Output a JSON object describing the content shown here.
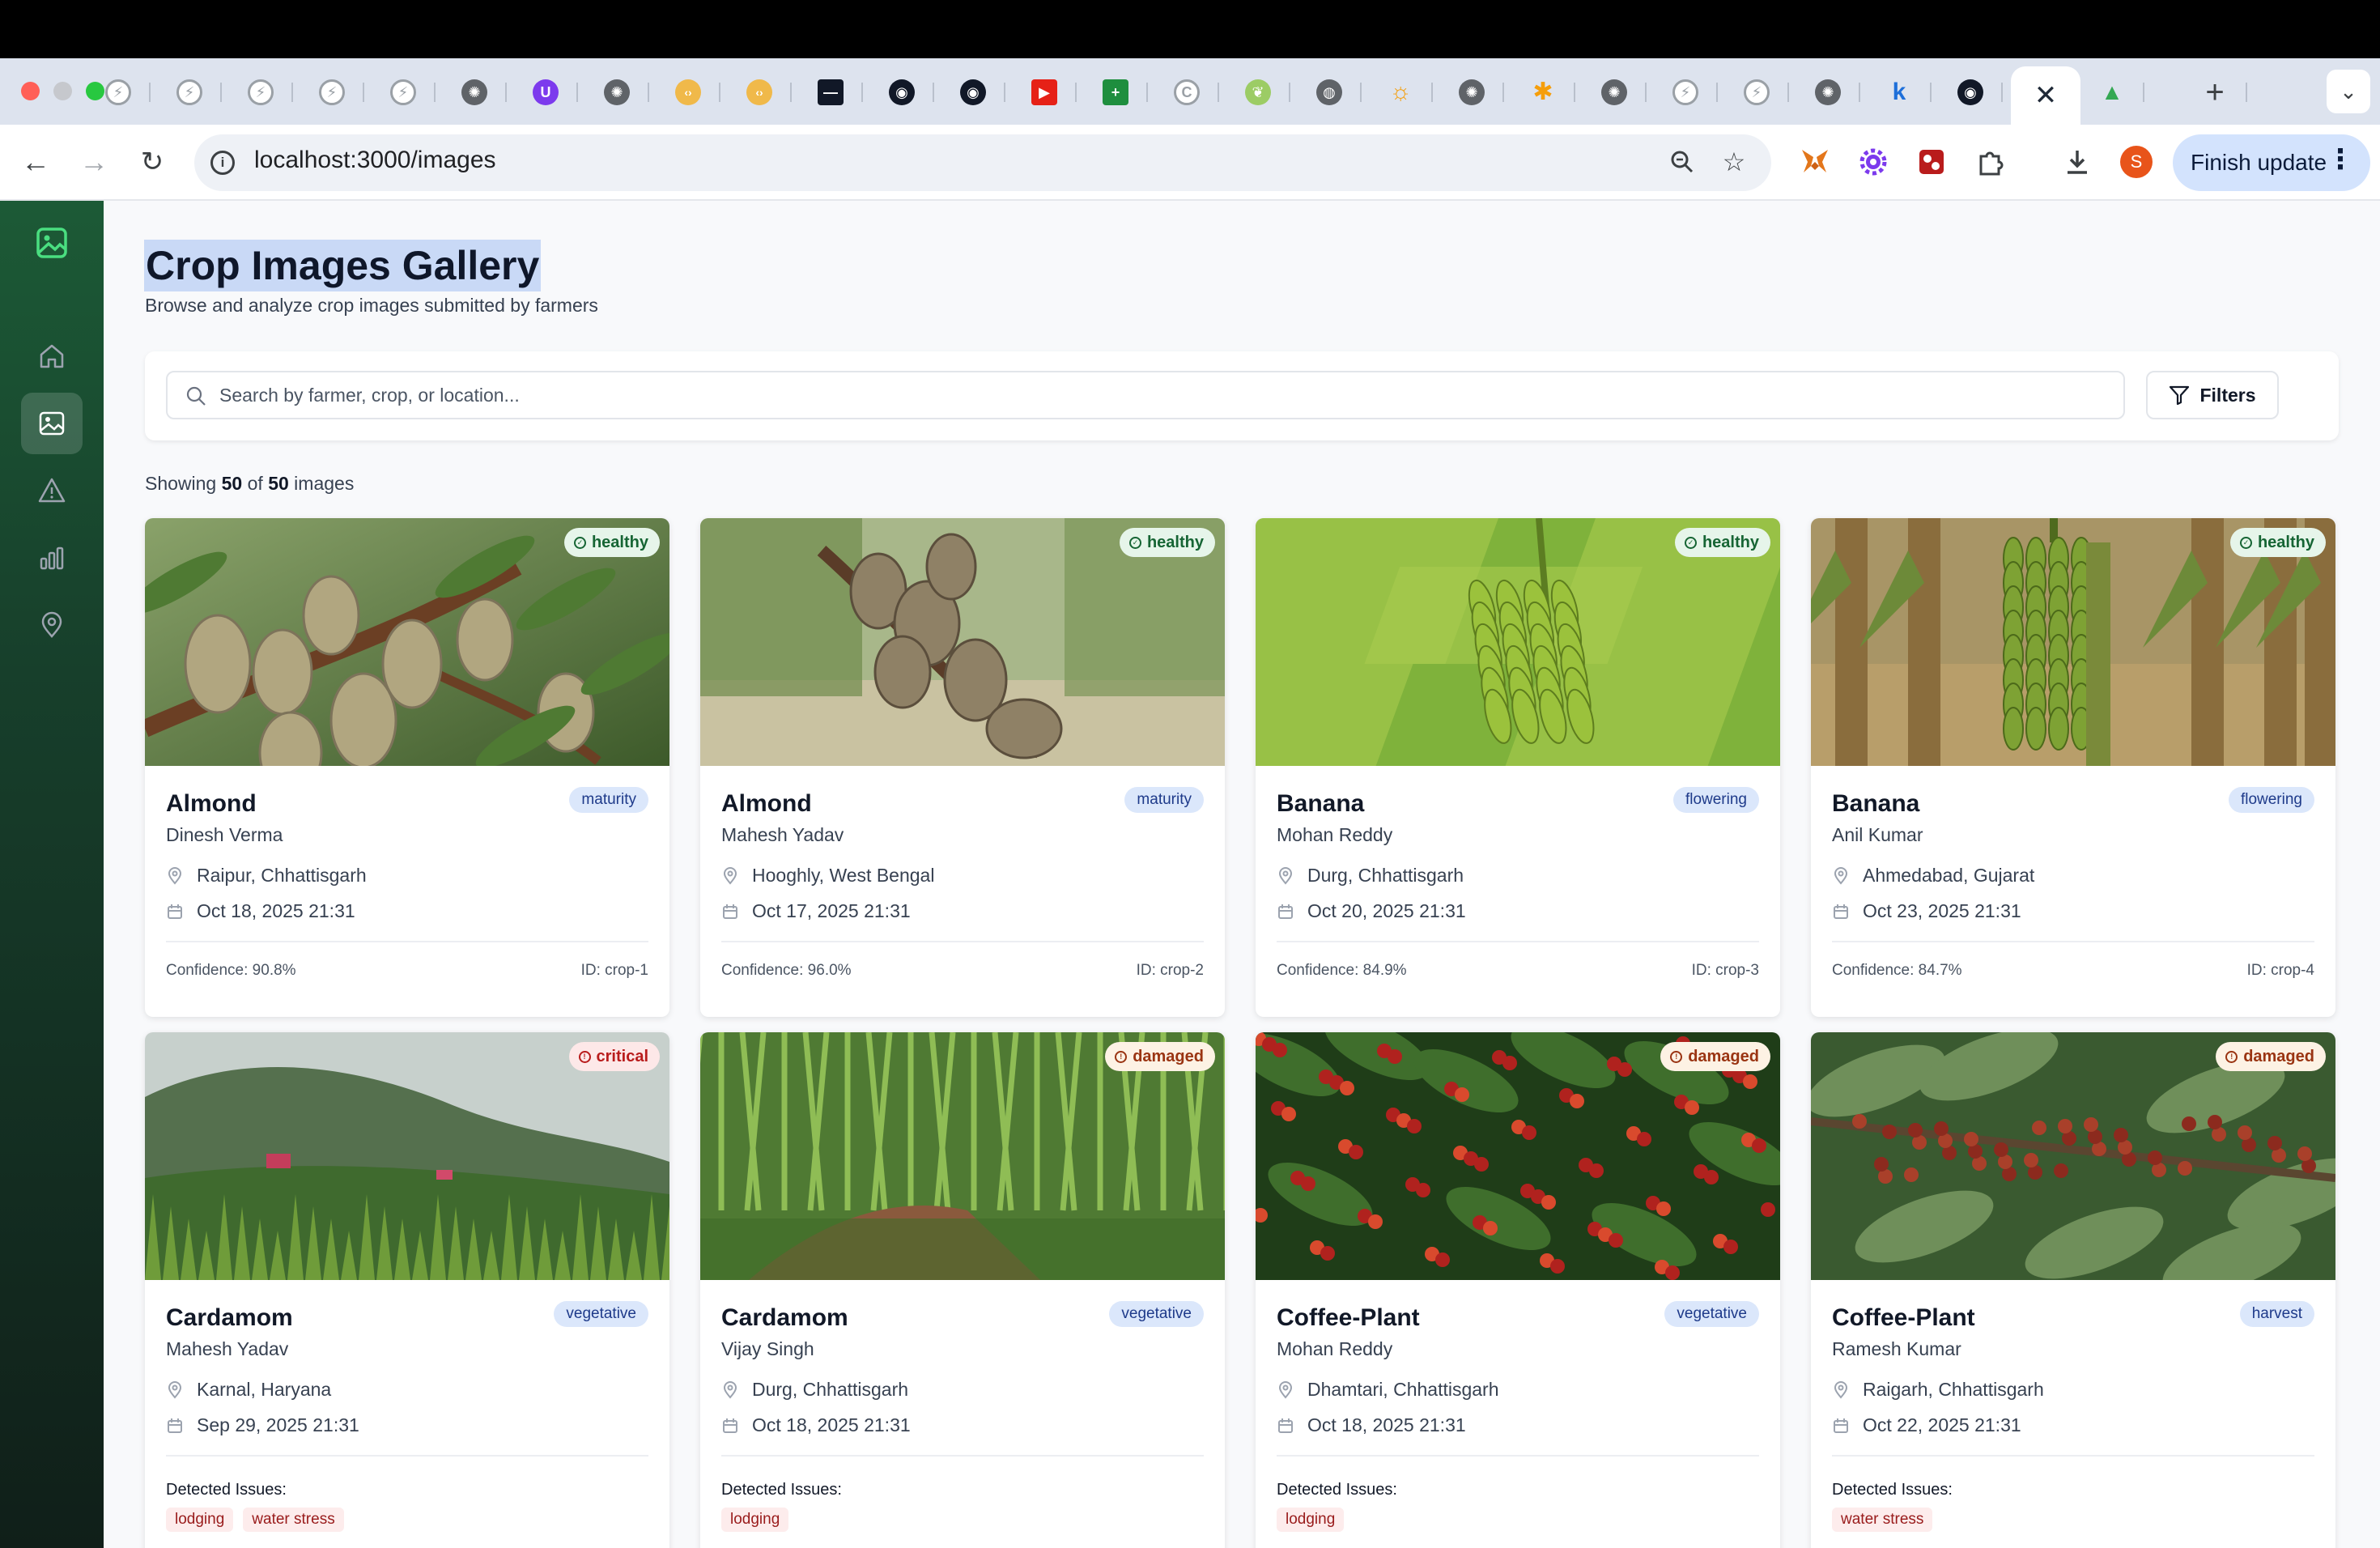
{
  "browser": {
    "url": "localhost:3000/images",
    "finish_update_label": "Finish update",
    "profile_initial": "S",
    "tabs": [
      {
        "icon": "claude-icon"
      },
      {
        "icon": "claude-icon"
      },
      {
        "icon": "claude-icon"
      },
      {
        "icon": "claude-icon"
      },
      {
        "icon": "claude-icon"
      },
      {
        "icon": "chatgpt-icon"
      },
      {
        "icon": "shield-u-icon"
      },
      {
        "icon": "chatgpt-icon"
      },
      {
        "icon": "code-icon"
      },
      {
        "icon": "code-icon"
      },
      {
        "icon": "terminal-icon"
      },
      {
        "icon": "github-icon"
      },
      {
        "icon": "github-icon"
      },
      {
        "icon": "youtube-icon"
      },
      {
        "icon": "sheets-icon"
      },
      {
        "icon": "c-icon"
      },
      {
        "icon": "leaf-icon"
      },
      {
        "icon": "globe-icon"
      },
      {
        "icon": "sun-icon"
      },
      {
        "icon": "chatgpt-icon"
      },
      {
        "icon": "bulb-icon"
      },
      {
        "icon": "chatgpt-icon"
      },
      {
        "icon": "claude-icon"
      },
      {
        "icon": "claude-icon"
      },
      {
        "icon": "chatgpt-icon"
      },
      {
        "icon": "k-icon",
        "text": "k"
      },
      {
        "icon": "github-icon"
      },
      {
        "icon": "close-icon",
        "active": true
      },
      {
        "icon": "drive-icon"
      }
    ]
  },
  "sidebar": {
    "items": [
      {
        "name": "home"
      },
      {
        "name": "images",
        "active": true
      },
      {
        "name": "alerts"
      },
      {
        "name": "analytics"
      },
      {
        "name": "locations"
      }
    ]
  },
  "page": {
    "title": "Crop Images Gallery",
    "subtitle": "Browse and analyze crop images submitted by farmers",
    "search_placeholder": "Search by farmer, crop, or location...",
    "filters_label": "Filters",
    "showing": {
      "prefix": "Showing",
      "shown": "50",
      "of": "of",
      "total": "50",
      "suffix": "images"
    }
  },
  "colors": {
    "accent": "#1c5a36",
    "healthy": "#166534",
    "critical": "#b91c1c",
    "damaged": "#9a3412",
    "stage": "#1e3a8a"
  },
  "cards": [
    {
      "crop": "Almond",
      "farmer": "Dinesh Verma",
      "status": "healthy",
      "stage": "maturity",
      "location": "Raipur, Chhattisgarh",
      "date": "Oct 18, 2025 21:31",
      "confidence": "Confidence: 90.8%",
      "id": "ID: crop-1"
    },
    {
      "crop": "Almond",
      "farmer": "Mahesh Yadav",
      "status": "healthy",
      "stage": "maturity",
      "location": "Hooghly, West Bengal",
      "date": "Oct 17, 2025 21:31",
      "confidence": "Confidence: 96.0%",
      "id": "ID: crop-2"
    },
    {
      "crop": "Banana",
      "farmer": "Mohan Reddy",
      "status": "healthy",
      "stage": "flowering",
      "location": "Durg, Chhattisgarh",
      "date": "Oct 20, 2025 21:31",
      "confidence": "Confidence: 84.9%",
      "id": "ID: crop-3"
    },
    {
      "crop": "Banana",
      "farmer": "Anil Kumar",
      "status": "healthy",
      "stage": "flowering",
      "location": "Ahmedabad, Gujarat",
      "date": "Oct 23, 2025 21:31",
      "confidence": "Confidence: 84.7%",
      "id": "ID: crop-4"
    },
    {
      "crop": "Cardamom",
      "farmer": "Mahesh Yadav",
      "status": "critical",
      "stage": "vegetative",
      "location": "Karnal, Haryana",
      "date": "Sep 29, 2025 21:31",
      "issues_label": "Detected Issues:",
      "issues": [
        "lodging",
        "water stress"
      ]
    },
    {
      "crop": "Cardamom",
      "farmer": "Vijay Singh",
      "status": "damaged",
      "stage": "vegetative",
      "location": "Durg, Chhattisgarh",
      "date": "Oct 18, 2025 21:31",
      "issues_label": "Detected Issues:",
      "issues": [
        "lodging"
      ]
    },
    {
      "crop": "Coffee-Plant",
      "farmer": "Mohan Reddy",
      "status": "damaged",
      "stage": "vegetative",
      "location": "Dhamtari, Chhattisgarh",
      "date": "Oct 18, 2025 21:31",
      "issues_label": "Detected Issues:",
      "issues": [
        "lodging"
      ]
    },
    {
      "crop": "Coffee-Plant",
      "farmer": "Ramesh Kumar",
      "status": "damaged",
      "stage": "harvest",
      "location": "Raigarh, Chhattisgarh",
      "date": "Oct 22, 2025 21:31",
      "issues_label": "Detected Issues:",
      "issues": [
        "water stress"
      ]
    }
  ]
}
